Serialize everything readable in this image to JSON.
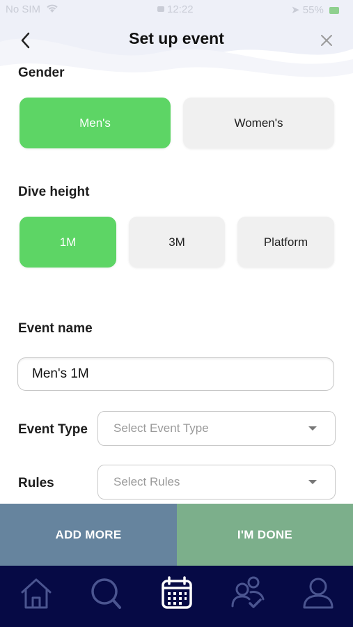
{
  "status_bar": {
    "carrier": "No SIM",
    "time": "12:22",
    "battery": "55%"
  },
  "header": {
    "title": "Set up event"
  },
  "gender": {
    "label": "Gender",
    "options": [
      "Men's",
      "Women's"
    ],
    "selected": "Men's"
  },
  "dive_height": {
    "label": "Dive height",
    "options": [
      "1M",
      "3M",
      "Platform"
    ],
    "selected": "1M"
  },
  "event_name": {
    "label": "Event name",
    "value": "Men's 1M"
  },
  "event_type": {
    "label": "Event Type",
    "placeholder": "Select Event Type"
  },
  "rules": {
    "label": "Rules",
    "placeholder": "Select Rules"
  },
  "actions": {
    "add_more": "ADD MORE",
    "done": "I'M DONE"
  },
  "tabbar": {
    "icons": [
      "home-icon",
      "search-icon",
      "calendar-icon",
      "users-check-icon",
      "profile-icon"
    ],
    "active": "calendar-icon"
  },
  "colors": {
    "selected": "#5dd565",
    "add_more": "#66849e",
    "done": "#7caf8b",
    "tabbar": "#060a45"
  }
}
